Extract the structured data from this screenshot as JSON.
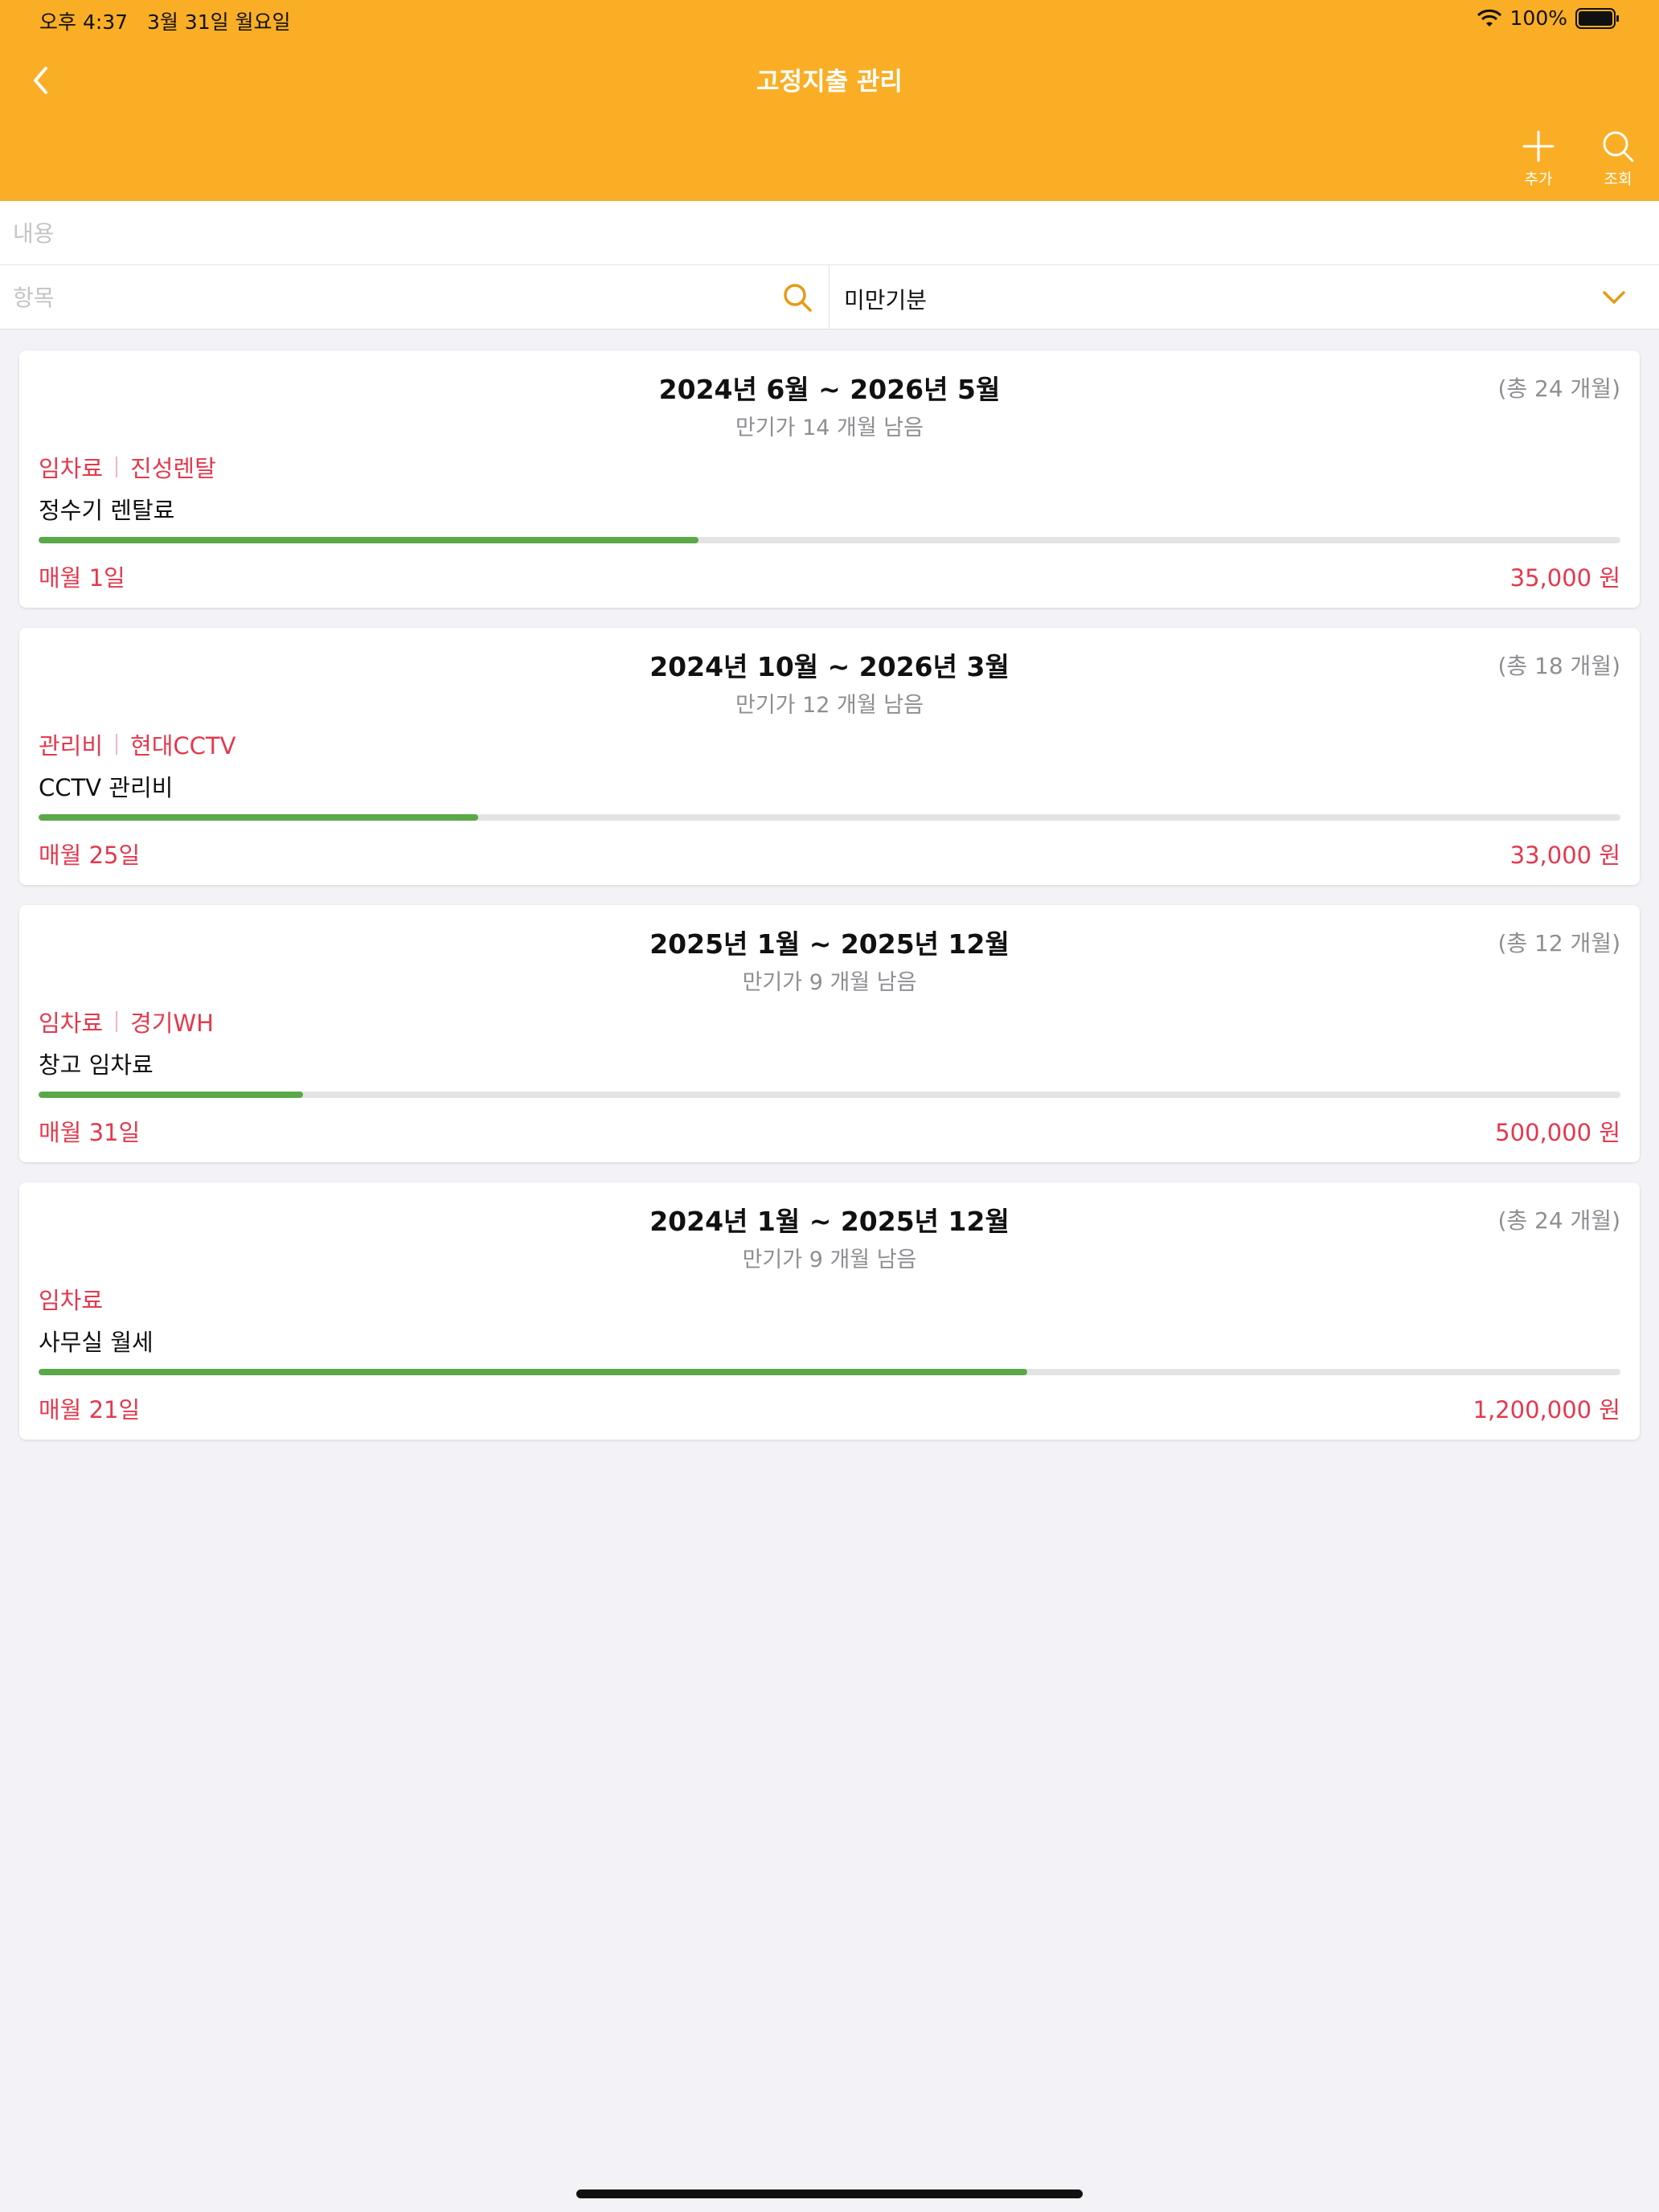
{
  "status_bar": {
    "time": "오후 4:37",
    "date": "3월 31일 월요일",
    "battery": "100%"
  },
  "header": {
    "title": "고정지출 관리",
    "add_label": "추가",
    "search_label": "조회"
  },
  "filters": {
    "content_placeholder": "내용",
    "item_placeholder": "항목",
    "status_select": "미만기분"
  },
  "items": [
    {
      "period": "2024년 6월 ~ 2026년 5월",
      "total": "(총 24 개월)",
      "remaining": "만기가 14 개월 남음",
      "category": "임차료",
      "vendor": "진성렌탈",
      "name": "정수기 렌탈료",
      "pay_day": "매월 1일",
      "amount": "35,000 원",
      "progress": 0.417
    },
    {
      "period": "2024년 10월 ~ 2026년 3월",
      "total": "(총 18 개월)",
      "remaining": "만기가 12 개월 남음",
      "category": "관리비",
      "vendor": "현대CCTV",
      "name": "CCTV 관리비",
      "pay_day": "매월 25일",
      "amount": "33,000 원",
      "progress": 0.278
    },
    {
      "period": "2025년 1월 ~ 2025년 12월",
      "total": "(총 12 개월)",
      "remaining": "만기가 9 개월 남음",
      "category": "임차료",
      "vendor": "경기WH",
      "name": "창고 임차료",
      "pay_day": "매월 31일",
      "amount": "500,000 원",
      "progress": 0.167
    },
    {
      "period": "2024년 1월 ~ 2025년 12월",
      "total": "(총 24 개월)",
      "remaining": "만기가 9 개월 남음",
      "category": "임차료",
      "vendor": "",
      "name": "사무실 월세",
      "pay_day": "매월 21일",
      "amount": "1,200,000 원",
      "progress": 0.625
    }
  ],
  "colors": {
    "accent": "#f9ae25",
    "alert_text": "#e3394e",
    "progress": "#5ba849"
  }
}
